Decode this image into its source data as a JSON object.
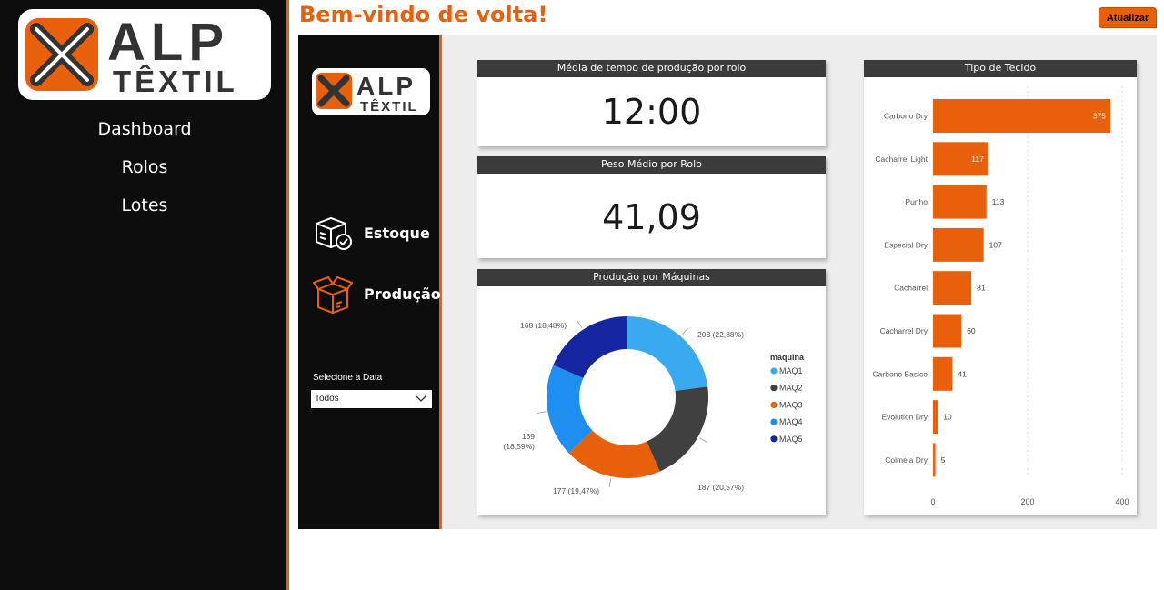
{
  "sidebar": {
    "brand_top": "ALP",
    "brand_bottom": "TÊXTIL",
    "nav": [
      {
        "label": "Dashboard"
      },
      {
        "label": "Rolos"
      },
      {
        "label": "Lotes"
      }
    ]
  },
  "header": {
    "title": "Bem-vindo de volta!",
    "refresh_label": "Atualizar"
  },
  "report": {
    "brand_top": "ALP",
    "brand_bottom": "TÊXTIL",
    "nav": [
      {
        "label": "Estoque",
        "icon": "boxes-check-icon"
      },
      {
        "label": "Produção",
        "icon": "open-box-icon"
      }
    ],
    "date_filter": {
      "label": "Selecione a Data",
      "value": "Todos"
    },
    "kpis": [
      {
        "title": "Média de tempo de produção por rolo",
        "value": "12:00"
      },
      {
        "title": "Peso Médio por Rolo",
        "value": "41,09"
      }
    ],
    "colors": {
      "accent": "#e8600c",
      "header_bar": "#3b3b3b",
      "dark_bg": "#0d0d0d"
    }
  },
  "chart_data": [
    {
      "type": "pie",
      "title": "Produção por Máquinas",
      "legend_title": "maquina",
      "legend_position": "right",
      "labels": [
        "MAQ1",
        "MAQ2",
        "MAQ3",
        "MAQ4",
        "MAQ5"
      ],
      "values": [
        208,
        187,
        177,
        169,
        168
      ],
      "value_labels": [
        "208 (22,88%)",
        "187 (20,57%)",
        "177 (19,47%)",
        "169 (18,59%)",
        "168 (18,48%)"
      ],
      "colors": [
        "#3aaaf0",
        "#404040",
        "#e8600c",
        "#1e8ff0",
        "#1526a0"
      ]
    },
    {
      "type": "bar",
      "orientation": "horizontal",
      "title": "Tipo de Tecido",
      "categories": [
        "Carbono Dry",
        "Cacharrel Light",
        "Punho",
        "Especial Dry",
        "Cacharrel",
        "Cacharrel Dry",
        "Carbono Basico",
        "Evolution Dry",
        "Colmeia Dry"
      ],
      "values": [
        375,
        117,
        113,
        107,
        81,
        60,
        41,
        10,
        5
      ],
      "xlim": [
        0,
        400
      ],
      "xticks": [
        0,
        200,
        400
      ],
      "color": "#e8600c",
      "grid": true
    }
  ]
}
